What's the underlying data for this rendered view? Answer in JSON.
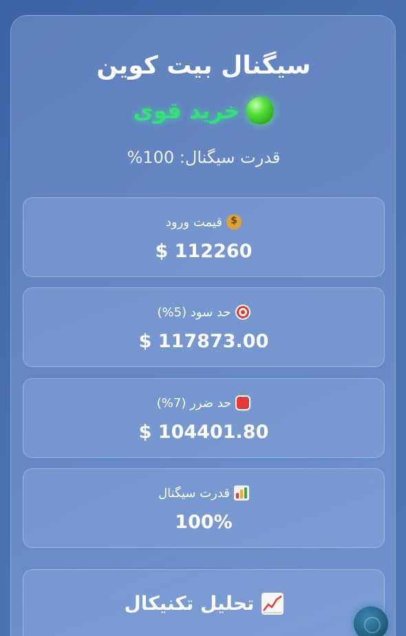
{
  "title": "سیگنال بیت کوین",
  "signal": {
    "icon": "green-circle-icon",
    "label": "خرید قوی",
    "color": "#34e07a"
  },
  "strength_line": "قدرت سیگنال: 100%",
  "cards": {
    "entry": {
      "icon": "money-bag-icon",
      "label": "قیمت ورود",
      "value": "$ 112260"
    },
    "take_profit": {
      "icon": "target-icon",
      "label": "حد سود (5%)",
      "value": "$ 117873.00"
    },
    "stop_loss": {
      "icon": "stop-sign-icon",
      "label": "حد ضرر (7%)",
      "value": "$ 104401.80"
    },
    "strength": {
      "icon": "bar-chart-icon",
      "label": "قدرت سیگنال",
      "value": "100%"
    }
  },
  "analysis": {
    "icon": "chart-increasing-icon",
    "title": "تحلیل تکنیکال"
  },
  "fab": {
    "icon": "chat-icon"
  }
}
